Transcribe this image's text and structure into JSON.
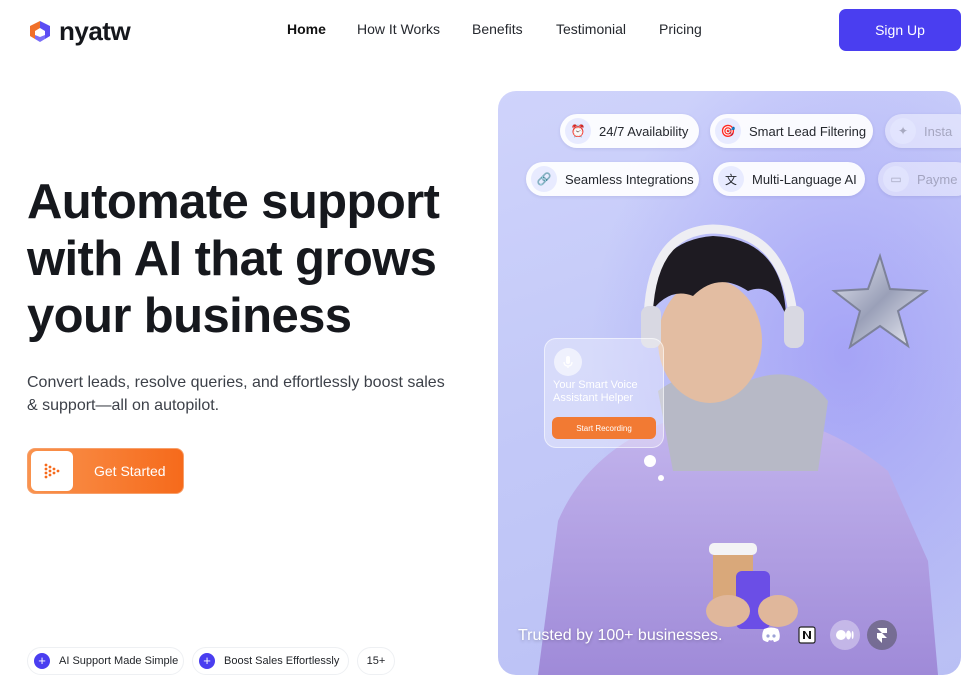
{
  "brand": {
    "name": "nyatw",
    "logo_icon": "cube-logo-icon"
  },
  "nav": {
    "links": [
      {
        "label": "Home",
        "active": true
      },
      {
        "label": "How It Works",
        "active": false
      },
      {
        "label": "Benefits",
        "active": false
      },
      {
        "label": "Testimonial",
        "active": false
      },
      {
        "label": "Pricing",
        "active": false
      }
    ],
    "signup_label": "Sign Up"
  },
  "hero": {
    "headline": "Automate support with AI that grows your business",
    "subhead": "Convert leads, resolve queries, and effortlessly boost sales & support—all on autopilot.",
    "cta_label": "Get Started",
    "cta_icon": "arrow-dots-icon",
    "features": [
      {
        "label": "AI Support Made Simple",
        "icon": "plus-icon"
      },
      {
        "label": "Boost Sales Effortlessly",
        "icon": "plus-icon"
      },
      {
        "label": "15+"
      }
    ]
  },
  "card": {
    "chips_row1": [
      {
        "label": "24/7 Availability",
        "icon": "alarm-clock-icon"
      },
      {
        "label": "Smart Lead Filtering",
        "icon": "target-icon"
      },
      {
        "label": "Insta",
        "icon": "sparkle-icon"
      }
    ],
    "chips_row2": [
      {
        "label": "Seamless Integrations",
        "icon": "link-icon"
      },
      {
        "label": "Multi-Language AI",
        "icon": "translate-icon"
      },
      {
        "label": "Payme",
        "icon": "card-icon"
      }
    ],
    "voice": {
      "title": "Your Smart Voice Assistant Helper",
      "button": "Start Recording",
      "icon": "microphone-icon"
    },
    "trusted": "Trusted by 100+ businesses.",
    "brands": [
      "discord-icon",
      "notion-icon",
      "medium-icon",
      "framer-icon"
    ],
    "accent": "#4a3ef0",
    "cta_color": "#f66a1b"
  }
}
